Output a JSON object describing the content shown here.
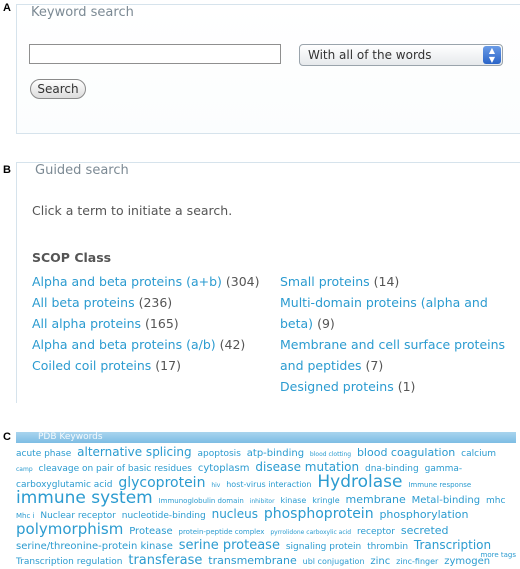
{
  "panel_labels": {
    "a": "A",
    "b": "B",
    "c": "C"
  },
  "keyword_search": {
    "legend": "Keyword search",
    "input_value": "",
    "select_value": "With all of the words",
    "button_label": "Search"
  },
  "guided_search": {
    "legend": "Guided search",
    "instruction": "Click a term to initiate a search.",
    "scop_title": "SCOP Class",
    "left_items": [
      {
        "label": "Alpha and beta proteins (a+b)",
        "count": "(304)"
      },
      {
        "label": "All beta proteins",
        "count": "(236)"
      },
      {
        "label": "All alpha proteins",
        "count": "(165)"
      },
      {
        "label": "Alpha and beta proteins (a/b)",
        "count": "(42)"
      },
      {
        "label": "Coiled coil proteins",
        "count": "(17)"
      }
    ],
    "right_items": [
      {
        "label": "Small proteins",
        "count": "(14)"
      },
      {
        "label": "Multi-domain proteins (alpha and",
        "count": ""
      },
      {
        "label": "beta)",
        "count": "(9)"
      },
      {
        "label": "Membrane and cell surface proteins",
        "count": ""
      },
      {
        "label": "and peptides",
        "count": "(7)"
      },
      {
        "label": "Designed proteins",
        "count": "(1)"
      }
    ]
  },
  "pdb_keywords": {
    "header": "PDB Keywords",
    "more_label": "more tags",
    "tags": [
      {
        "t": "acute phase",
        "s": 9
      },
      {
        "t": "alternative splicing",
        "s": 12
      },
      {
        "t": "apoptosis",
        "s": 9
      },
      {
        "t": "atp-binding",
        "s": 10
      },
      {
        "t": "blood clotting",
        "s": 6
      },
      {
        "t": "blood coagulation",
        "s": 11
      },
      {
        "t": "calcium",
        "s": 9
      },
      {
        "t": "camp",
        "s": 6
      },
      {
        "t": "cleavage on pair of basic residues",
        "s": 9
      },
      {
        "t": "cytoplasm",
        "s": 10
      },
      {
        "t": "disease mutation",
        "s": 12
      },
      {
        "t": "dna-binding",
        "s": 9
      },
      {
        "t": "gamma-carboxyglutamic acid",
        "s": 9
      },
      {
        "t": "glycoprotein",
        "s": 14
      },
      {
        "t": "hiv",
        "s": 6
      },
      {
        "t": "host-virus interaction",
        "s": 8
      },
      {
        "t": "Hydrolase",
        "s": 17
      },
      {
        "t": "Immune response",
        "s": 7
      },
      {
        "t": "immune system",
        "s": 17
      },
      {
        "t": "Immunoglobulin domain",
        "s": 7
      },
      {
        "t": "inhibitor",
        "s": 6
      },
      {
        "t": "kinase",
        "s": 8
      },
      {
        "t": "kringle",
        "s": 8
      },
      {
        "t": "membrane",
        "s": 11
      },
      {
        "t": "Metal-binding",
        "s": 10
      },
      {
        "t": "mhc",
        "s": 9
      },
      {
        "t": "Mhc i",
        "s": 7
      },
      {
        "t": "Nuclear receptor",
        "s": 9
      },
      {
        "t": "nucleotide-binding",
        "s": 9
      },
      {
        "t": "nucleus",
        "s": 12
      },
      {
        "t": "phosphoprotein",
        "s": 14
      },
      {
        "t": "phosphorylation",
        "s": 11
      },
      {
        "t": "polymorphism",
        "s": 15
      },
      {
        "t": "Protease",
        "s": 10
      },
      {
        "t": "protein-peptide complex",
        "s": 7
      },
      {
        "t": "pyrrolidone carboxylic acid",
        "s": 6
      },
      {
        "t": "receptor",
        "s": 9
      },
      {
        "t": "secreted",
        "s": 11
      },
      {
        "t": "serine/threonine-protein kinase",
        "s": 10
      },
      {
        "t": "serine protease",
        "s": 13
      },
      {
        "t": "signaling protein",
        "s": 9
      },
      {
        "t": "thrombin",
        "s": 9
      },
      {
        "t": "Transcription",
        "s": 12
      },
      {
        "t": "Transcription regulation",
        "s": 9
      },
      {
        "t": "transferase",
        "s": 13
      },
      {
        "t": "transmembrane",
        "s": 11
      },
      {
        "t": "ubl conjugation",
        "s": 8
      },
      {
        "t": "zinc",
        "s": 10
      },
      {
        "t": "zinc-finger",
        "s": 8
      },
      {
        "t": "zymogen",
        "s": 10
      }
    ]
  }
}
